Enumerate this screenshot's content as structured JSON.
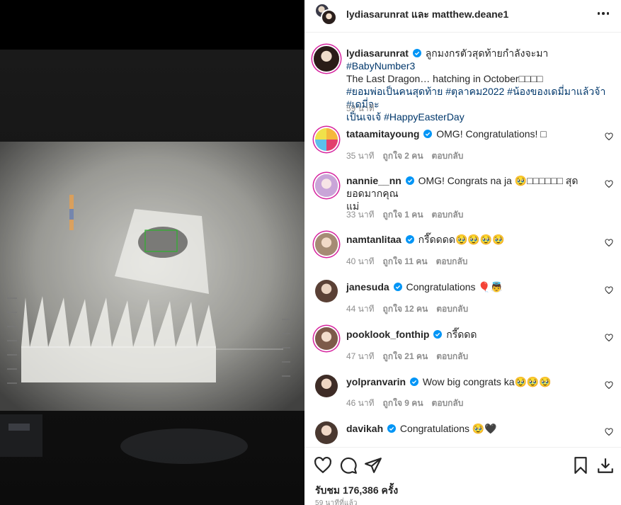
{
  "header": {
    "title": "lydiasarunrat และ matthew.deane1"
  },
  "caption": {
    "username": "lydiasarunrat",
    "text_line1": "ลูกมงกรตัวสุดท้ายกำลังจะมา",
    "hashtag1": "#BabyNumber3",
    "text_line2": "The Last Dragon… hatching in October□□□□",
    "hashtags_line3": "#ยอมพ่อเป็นคนสุดท้าย #ตุลาคม2022 #น้องของเดมี่มาแล้วจ้า #เดมี่จะ",
    "hashtags_line4a": "เป็นเจเจ้",
    "hashtags_line4b": "#HappyEasterDay",
    "time": "59 นาที"
  },
  "comments": [
    {
      "username": "tataamitayoung",
      "text": "OMG! Congratulations! □",
      "time": "35 นาที",
      "likes": "ถูกใจ 2 คน",
      "reply": "ตอบกลับ"
    },
    {
      "username": "nannie__nn",
      "text": "OMG! Congrats na ja 🥹□□□□□□ สุดยอดมากคุณ",
      "text2": "แม่",
      "time": "33 นาที",
      "likes": "ถูกใจ 1 คน",
      "reply": "ตอบกลับ"
    },
    {
      "username": "namtanlitaa",
      "text": "กรี๊ดดดด🥹🥹🥹🥹",
      "time": "40 นาที",
      "likes": "ถูกใจ 11 คน",
      "reply": "ตอบกลับ"
    },
    {
      "username": "janesuda",
      "text": "Congratulations 🎈👼",
      "time": "44 นาที",
      "likes": "ถูกใจ 12 คน",
      "reply": "ตอบกลับ"
    },
    {
      "username": "pooklook_fonthip",
      "text": "กรี๊ดดด",
      "time": "47 นาที",
      "likes": "ถูกใจ 21 คน",
      "reply": "ตอบกลับ"
    },
    {
      "username": "yolpranvarin",
      "text": "Wow big congrats ka🥹🥹🥹",
      "time": "46 นาที",
      "likes": "ถูกใจ 9 คน",
      "reply": "ตอบกลับ"
    },
    {
      "username": "davikah",
      "text": "Congratulations 🥹🖤"
    }
  ],
  "footer": {
    "likes": "รับชม 176,386 ครั้ง",
    "time_ago": "59 นาทีที่แล้ว"
  },
  "icons": {
    "more": "more-horizontal-icon",
    "verified": "verified-badge-icon",
    "heart": "heart-icon",
    "comment": "comment-icon",
    "share": "share-icon",
    "save": "bookmark-icon",
    "download": "download-icon"
  },
  "colors": {
    "hashtag": "#00376b",
    "verified": "#0095f6",
    "secondary_text": "#8e8e8e",
    "story_ring": "#d6249f"
  }
}
